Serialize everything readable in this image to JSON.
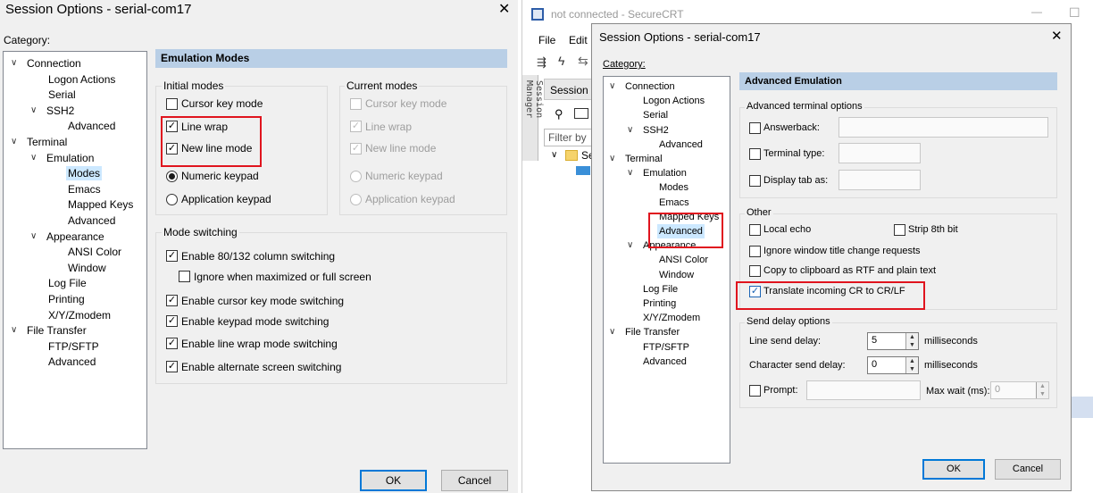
{
  "left_dialog": {
    "title": "Session Options - serial-com17",
    "close_glyph": "✕",
    "category_label": "Category:",
    "tree": [
      {
        "label": "Connection",
        "chev": "∨"
      },
      {
        "label": "Logon Actions"
      },
      {
        "label": "Serial"
      },
      {
        "label": "SSH2",
        "chev": "∨"
      },
      {
        "label": "Advanced"
      },
      {
        "label": "Terminal",
        "chev": "∨"
      },
      {
        "label": "Emulation",
        "chev": "∨"
      },
      {
        "label": "Modes",
        "selected": true
      },
      {
        "label": "Emacs"
      },
      {
        "label": "Mapped Keys"
      },
      {
        "label": "Advanced"
      },
      {
        "label": "Appearance",
        "chev": "∨"
      },
      {
        "label": "ANSI Color"
      },
      {
        "label": "Window"
      },
      {
        "label": "Log File"
      },
      {
        "label": "Printing"
      },
      {
        "label": "X/Y/Zmodem"
      },
      {
        "label": "File Transfer",
        "chev": "∨"
      },
      {
        "label": "FTP/SFTP"
      },
      {
        "label": "Advanced"
      }
    ],
    "header": "Emulation Modes",
    "initial_modes": {
      "title": "Initial modes",
      "cursor_key": "Cursor key mode",
      "line_wrap": "Line wrap",
      "new_line": "New line mode",
      "numeric": "Numeric keypad",
      "application": "Application keypad"
    },
    "current_modes": {
      "title": "Current modes",
      "cursor_key": "Cursor key mode",
      "line_wrap": "Line wrap",
      "new_line": "New line mode",
      "numeric": "Numeric keypad",
      "application": "Application keypad"
    },
    "mode_switching": {
      "title": "Mode switching",
      "col_switch": "Enable 80/132 column switching",
      "ignore_max": "Ignore when maximized or full screen",
      "cursor_switch": "Enable cursor key mode switching",
      "keypad_switch": "Enable keypad mode switching",
      "wrap_switch": "Enable line wrap mode switching",
      "alt_switch": "Enable alternate screen switching"
    },
    "ok": "OK",
    "cancel": "Cancel",
    "check_glyph": "✓"
  },
  "background_app": {
    "title": "not connected - SecureCRT",
    "menu_file": "File",
    "menu_edit": "Edit",
    "session_tab": "Session",
    "session_manager": "Session Manager",
    "filter": "Filter by",
    "tree_item": "Se",
    "min_glyph": "—",
    "max_glyph": "☐"
  },
  "right_dialog": {
    "title": "Session Options - serial-com17",
    "close_glyph": "✕",
    "category_label": "Category:",
    "tree": [
      {
        "label": "Connection",
        "chev": "∨"
      },
      {
        "label": "Logon Actions"
      },
      {
        "label": "Serial"
      },
      {
        "label": "SSH2",
        "chev": "∨"
      },
      {
        "label": "Advanced"
      },
      {
        "label": "Terminal",
        "chev": "∨"
      },
      {
        "label": "Emulation",
        "chev": "∨"
      },
      {
        "label": "Modes"
      },
      {
        "label": "Emacs"
      },
      {
        "label": "Mapped Keys"
      },
      {
        "label": "Advanced",
        "selected": true
      },
      {
        "label": "Appearance",
        "chev": "∨"
      },
      {
        "label": "ANSI Color"
      },
      {
        "label": "Window"
      },
      {
        "label": "Log File"
      },
      {
        "label": "Printing"
      },
      {
        "label": "X/Y/Zmodem"
      },
      {
        "label": "File Transfer",
        "chev": "∨"
      },
      {
        "label": "FTP/SFTP"
      },
      {
        "label": "Advanced"
      }
    ],
    "header": "Advanced Emulation",
    "terminal_options": {
      "title": "Advanced terminal options",
      "answerback": "Answerback:",
      "terminal_type": "Terminal type:",
      "display_tab": "Display tab as:"
    },
    "other": {
      "title": "Other",
      "local_echo": "Local echo",
      "strip_8th": "Strip 8th bit",
      "ignore_title": "Ignore window title change requests",
      "copy_rtf": "Copy to clipboard as RTF and plain text",
      "translate_cr": "Translate incoming CR to CR/LF"
    },
    "send_delay": {
      "title": "Send delay options",
      "line_label": "Line send delay:",
      "line_value": "5",
      "char_label": "Character send delay:",
      "char_value": "0",
      "unit": "milliseconds",
      "prompt_label": "Prompt:",
      "max_wait_label": "Max wait (ms):",
      "max_wait_value": "0"
    },
    "ok": "OK",
    "cancel": "Cancel",
    "check_glyph": "✓"
  }
}
